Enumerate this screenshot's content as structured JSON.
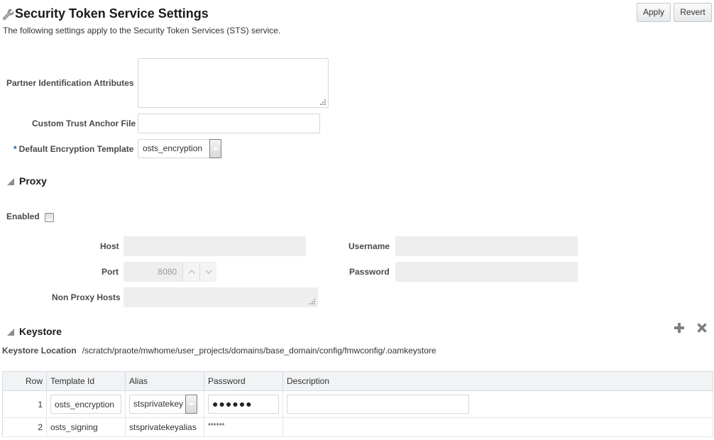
{
  "header": {
    "icon": "wrench-icon",
    "title": "Security Token Service Settings",
    "description": "The following settings apply to the Security Token Services (STS) service.",
    "buttons": {
      "apply": "Apply",
      "revert": "Revert"
    }
  },
  "settings": {
    "partner_identification_attributes": {
      "label": "Partner Identification Attributes",
      "value": ""
    },
    "custom_trust_anchor_file": {
      "label": "Custom Trust Anchor File",
      "value": ""
    },
    "default_encryption_template": {
      "label": "Default Encryption Template",
      "required_marker": "*",
      "selected": "osts_encryption"
    }
  },
  "proxy": {
    "section_title": "Proxy",
    "enabled": {
      "label": "Enabled",
      "checked": false
    },
    "host": {
      "label": "Host",
      "value": ""
    },
    "port": {
      "label": "Port",
      "value": "8080"
    },
    "non_proxy_hosts": {
      "label": "Non Proxy Hosts",
      "value": ""
    },
    "username": {
      "label": "Username",
      "value": ""
    },
    "password": {
      "label": "Password",
      "value": ""
    }
  },
  "keystore": {
    "section_title": "Keystore",
    "toolbar": {
      "add_icon": "plus-icon",
      "delete_icon": "close-icon"
    },
    "location_label": "Keystore Location",
    "location_value": "/scratch/praote/mwhome/user_projects/domains/base_domain/config/fmwconfig/.oamkeystore",
    "table": {
      "columns": [
        "Row",
        "Template Id",
        "Alias",
        "Password",
        "Description"
      ],
      "rows": [
        {
          "row": "1",
          "template_id": "osts_encryption",
          "alias": "stsprivatekey",
          "password": "●●●●●●",
          "description": "",
          "editing": true
        },
        {
          "row": "2",
          "template_id": "osts_signing",
          "alias": "stsprivatekeyalias",
          "password": "******",
          "description": "",
          "editing": false
        }
      ]
    }
  }
}
